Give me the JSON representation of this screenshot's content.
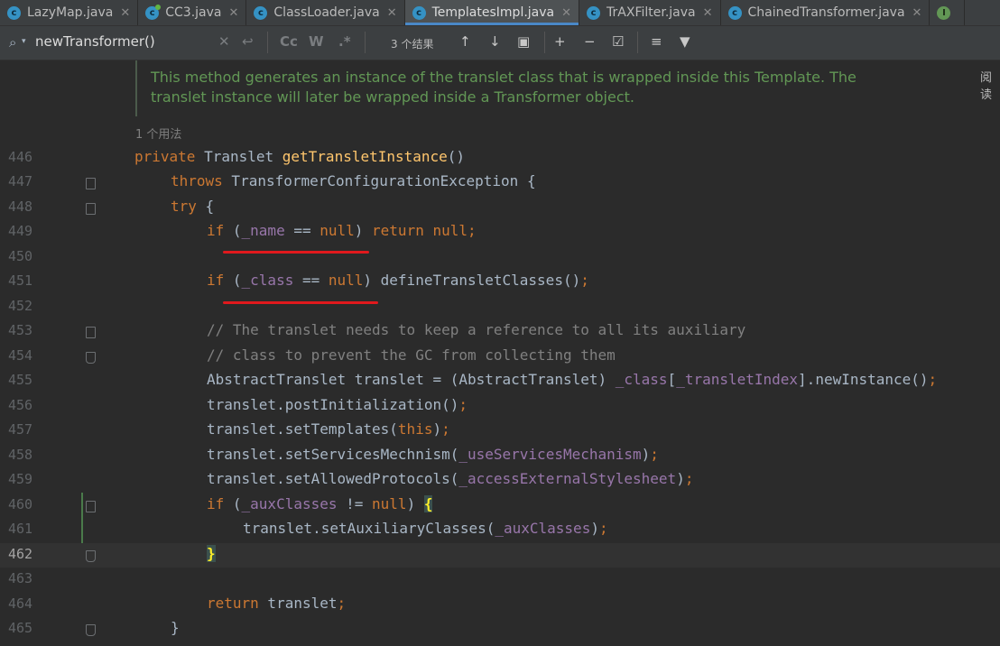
{
  "tabs": [
    {
      "label": "LazyMap.java",
      "icon": "c-icon"
    },
    {
      "label": "CC3.java",
      "icon": "c-icon"
    },
    {
      "label": "ClassLoader.java",
      "icon": "c-icon"
    },
    {
      "label": "TemplatesImpl.java",
      "icon": "c-icon",
      "active": true
    },
    {
      "label": "TrAXFilter.java",
      "icon": "c-icon"
    },
    {
      "label": "ChainedTransformer.java",
      "icon": "c-icon"
    },
    {
      "label": "I",
      "icon": "i-icon"
    }
  ],
  "search": {
    "query": "newTransformer()",
    "match_case": "Cc",
    "words": "W",
    "regex": ".*",
    "result_count": "3 个结果"
  },
  "doc_comment": {
    "line1": "This method generates an instance of the translet class that is wrapped inside this Template. The",
    "line2": "translet instance will later be wrapped inside a Transformer object."
  },
  "right_label": "阅读",
  "usage_hint": "1 个用法",
  "line_numbers": [
    "446",
    "447",
    "448",
    "449",
    "450",
    "451",
    "452",
    "453",
    "454",
    "455",
    "456",
    "457",
    "458",
    "459",
    "460",
    "461",
    "462",
    "463",
    "464",
    "465"
  ],
  "code": {
    "l446": {
      "kw": "private",
      "type": " Translet ",
      "fn": "getTransletInstance",
      "rest": "()"
    },
    "l447": {
      "kw": "throws",
      "rest": " TransformerConfigurationException {"
    },
    "l448": {
      "kw": "try",
      "rest": " {"
    },
    "l449": {
      "kw1": "if",
      "p1": " (",
      "fld": "_name",
      "op": " == ",
      "kw2": "null",
      "p2": ") ",
      "kw3": "return",
      "sp": " ",
      "kw4": "null;"
    },
    "l451": {
      "kw1": "if",
      "p1": " (",
      "fld": "_class",
      "op": " == ",
      "kw2": "null",
      "p2": ") defineTransletClasses()",
      "semi": ";"
    },
    "l453": "// The translet needs to keep a reference to all its auxiliary",
    "l454": "// class to prevent the GC from collecting them",
    "l455": {
      "a": "AbstractTranslet translet = (AbstractTranslet) ",
      "fld1": "_class",
      "b": "[",
      "fld2": "_transletIndex",
      "c": "].newInstance()",
      "semi": ";"
    },
    "l456": {
      "a": "translet.postInitialization()",
      "semi": ";"
    },
    "l457": {
      "a": "translet.setTemplates(",
      "kw": "this",
      "b": ")",
      "semi": ";"
    },
    "l458": {
      "a": "translet.setServicesMechnism(",
      "fld": "_useServicesMechanism",
      "b": ")",
      "semi": ";"
    },
    "l459": {
      "a": "translet.setAllowedProtocols(",
      "fld": "_accessExternalStylesheet",
      "b": ")",
      "semi": ";"
    },
    "l460": {
      "kw1": "if",
      "p1": " (",
      "fld": "_auxClasses",
      "op": " != ",
      "kw2": "null",
      "p2": ") ",
      "brace": "{"
    },
    "l461": {
      "a": "translet.setAuxiliaryClasses(",
      "fld": "_auxClasses",
      "b": ")",
      "semi": ";"
    },
    "l462": {
      "brace": "}"
    },
    "l464": {
      "kw": "return",
      "rest": " translet",
      "semi": ";"
    },
    "l465": "}"
  },
  "colors": {
    "background": "#2b2b2b",
    "keyword": "#cc7832",
    "method": "#ffc66d",
    "field": "#9876aa",
    "comment": "#808080",
    "doc_comment": "#629755",
    "annotation_underline": "#e0191d"
  }
}
